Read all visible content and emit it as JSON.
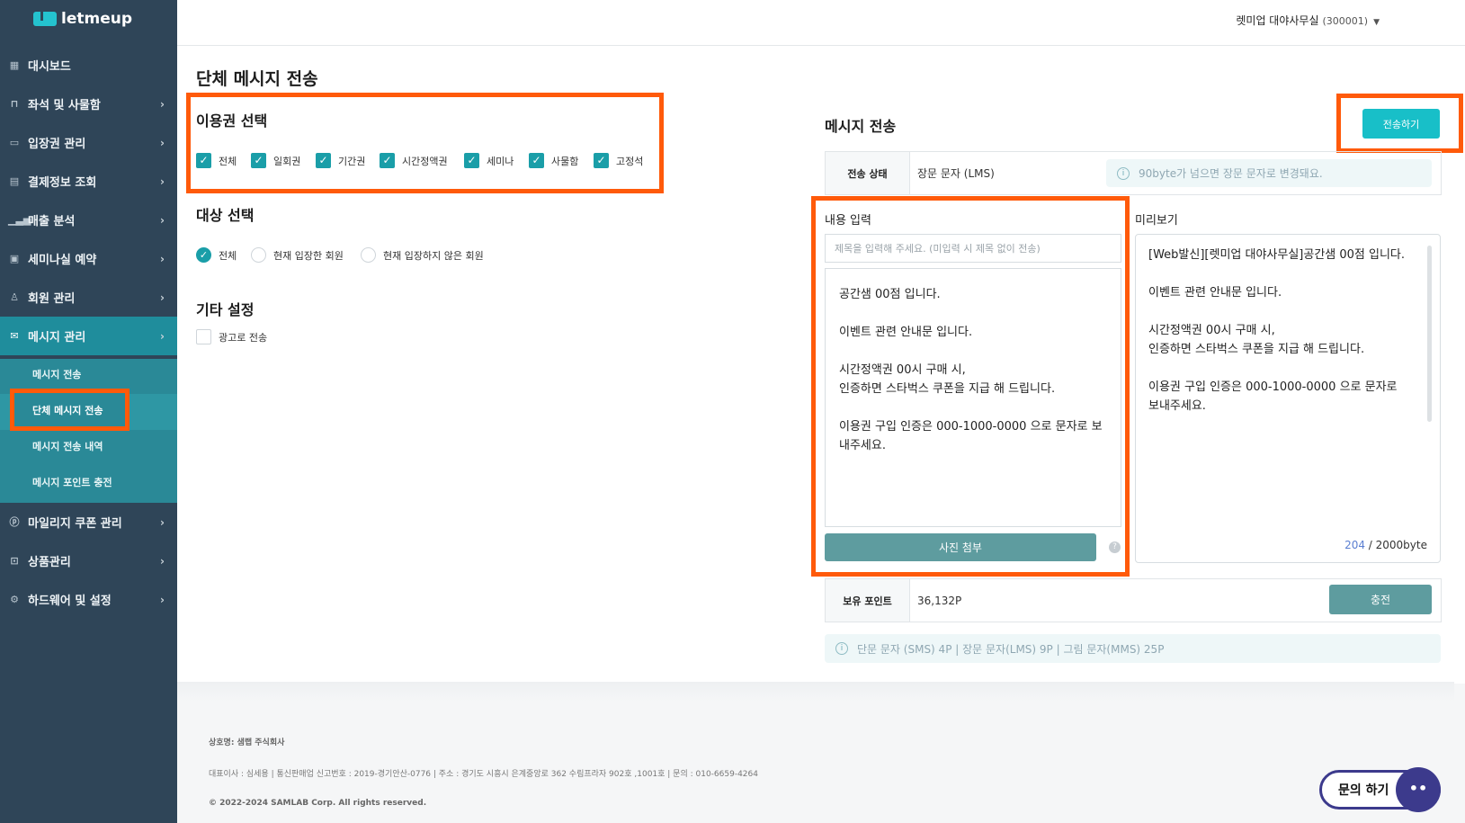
{
  "brand": {
    "name": "letmeup"
  },
  "sidebar": {
    "items": [
      {
        "label": "대시보드",
        "icon": "grid-icon"
      },
      {
        "label": "좌석 및 사물함",
        "icon": "seat-icon"
      },
      {
        "label": "입장권 관리",
        "icon": "ticket-icon"
      },
      {
        "label": "결제정보 조회",
        "icon": "card-icon"
      },
      {
        "label": "매출 분석",
        "icon": "bar-chart-icon"
      },
      {
        "label": "세미나실 예약",
        "icon": "calendar-icon"
      },
      {
        "label": "회원 관리",
        "icon": "users-icon"
      },
      {
        "label": "메시지 관리",
        "icon": "mail-icon"
      },
      {
        "label": "마일리지 쿠폰 관리",
        "icon": "coin-icon"
      },
      {
        "label": "상품관리",
        "icon": "bag-icon"
      },
      {
        "label": "하드웨어 및 설정",
        "icon": "gear-icon"
      }
    ],
    "sub_items": [
      "메시지 전송",
      "단체 메시지 전송",
      "메시지 전송 내역",
      "메시지 포인트 충전"
    ]
  },
  "header": {
    "org_name": "렛미업 대야사무실",
    "org_code": "(300001)"
  },
  "page": {
    "title": "단체 메시지 전송"
  },
  "ticket_select": {
    "title": "이용권 선택",
    "options": [
      {
        "label": "전체",
        "checked": true
      },
      {
        "label": "일회권",
        "checked": true
      },
      {
        "label": "기간권",
        "checked": true
      },
      {
        "label": "시간정액권",
        "checked": true
      },
      {
        "label": "세미나",
        "checked": true
      },
      {
        "label": "사물함",
        "checked": true
      },
      {
        "label": "고정석",
        "checked": true
      }
    ]
  },
  "target_select": {
    "title": "대상 선택",
    "options": [
      {
        "label": "전체",
        "selected": true
      },
      {
        "label": "현재 입장한 회원",
        "selected": false
      },
      {
        "label": "현재 입장하지 않은 회원",
        "selected": false
      }
    ]
  },
  "other_settings": {
    "title": "기타 설정",
    "ad_label": "광고로 전송",
    "ad_checked": false
  },
  "message": {
    "title": "메시지 전송",
    "send_button": "전송하기",
    "status_label": "전송 상태",
    "status_value": "장문 문자 (LMS)",
    "status_info": "90byte가 넘으면 장문 문자로 변경돼요.",
    "content_label": "내용 입력",
    "preview_label": "미리보기",
    "subject_placeholder": "제목을 입력해 주세요. (미입력 시 제목 없이 전송)",
    "body": "공간샘 00점 입니다.\n\n이벤트 관련 안내문 입니다.\n\n시간정액권 00시 구매 시,\n인증하면 스타벅스 쿠폰을 지급 해 드립니다.\n\n이용권 구입 인증은 000-1000-0000 으로 문자로 보내주세요.",
    "preview_text": "[Web발신][렛미업 대야사무실]공간샘 00점 입니다.\n\n이벤트 관련 안내문 입니다.\n\n시간정액권 00시 구매 시,\n인증하면 스타벅스 쿠폰을 지급 해 드립니다.\n\n이용권 구입 인증은 000-1000-0000 으로 문자로 보내주세요.",
    "byte_count": "204",
    "byte_limit": " / 2000byte",
    "attach_button": "사진 첨부",
    "points_label": "보유 포인트",
    "points_value": "36,132P",
    "charge_button": "충전",
    "price_info": "단문 문자 (SMS) 4P | 장문 문자(LMS) 9P | 그림 문자(MMS) 25P"
  },
  "footer": {
    "company": "상호명: 샘랩 주식회사",
    "details": "대표이사 : 심세용  |  통신판매업 신고번호 : 2019-경기안산-0776  |  주소 : 경기도 시흥시 은계중앙로 362 수림프라자 902호 ,1001호  |  문의 : 010-6659-4264",
    "copyright": "© 2022-2024 SAMLAB Corp. All rights reserved."
  },
  "inquiry_button": "문의 하기",
  "colors": {
    "sidebar": "#2f4558",
    "active": "#1f8d9c",
    "accent": "#18bfc8",
    "highlight": "#ff5a0a"
  }
}
